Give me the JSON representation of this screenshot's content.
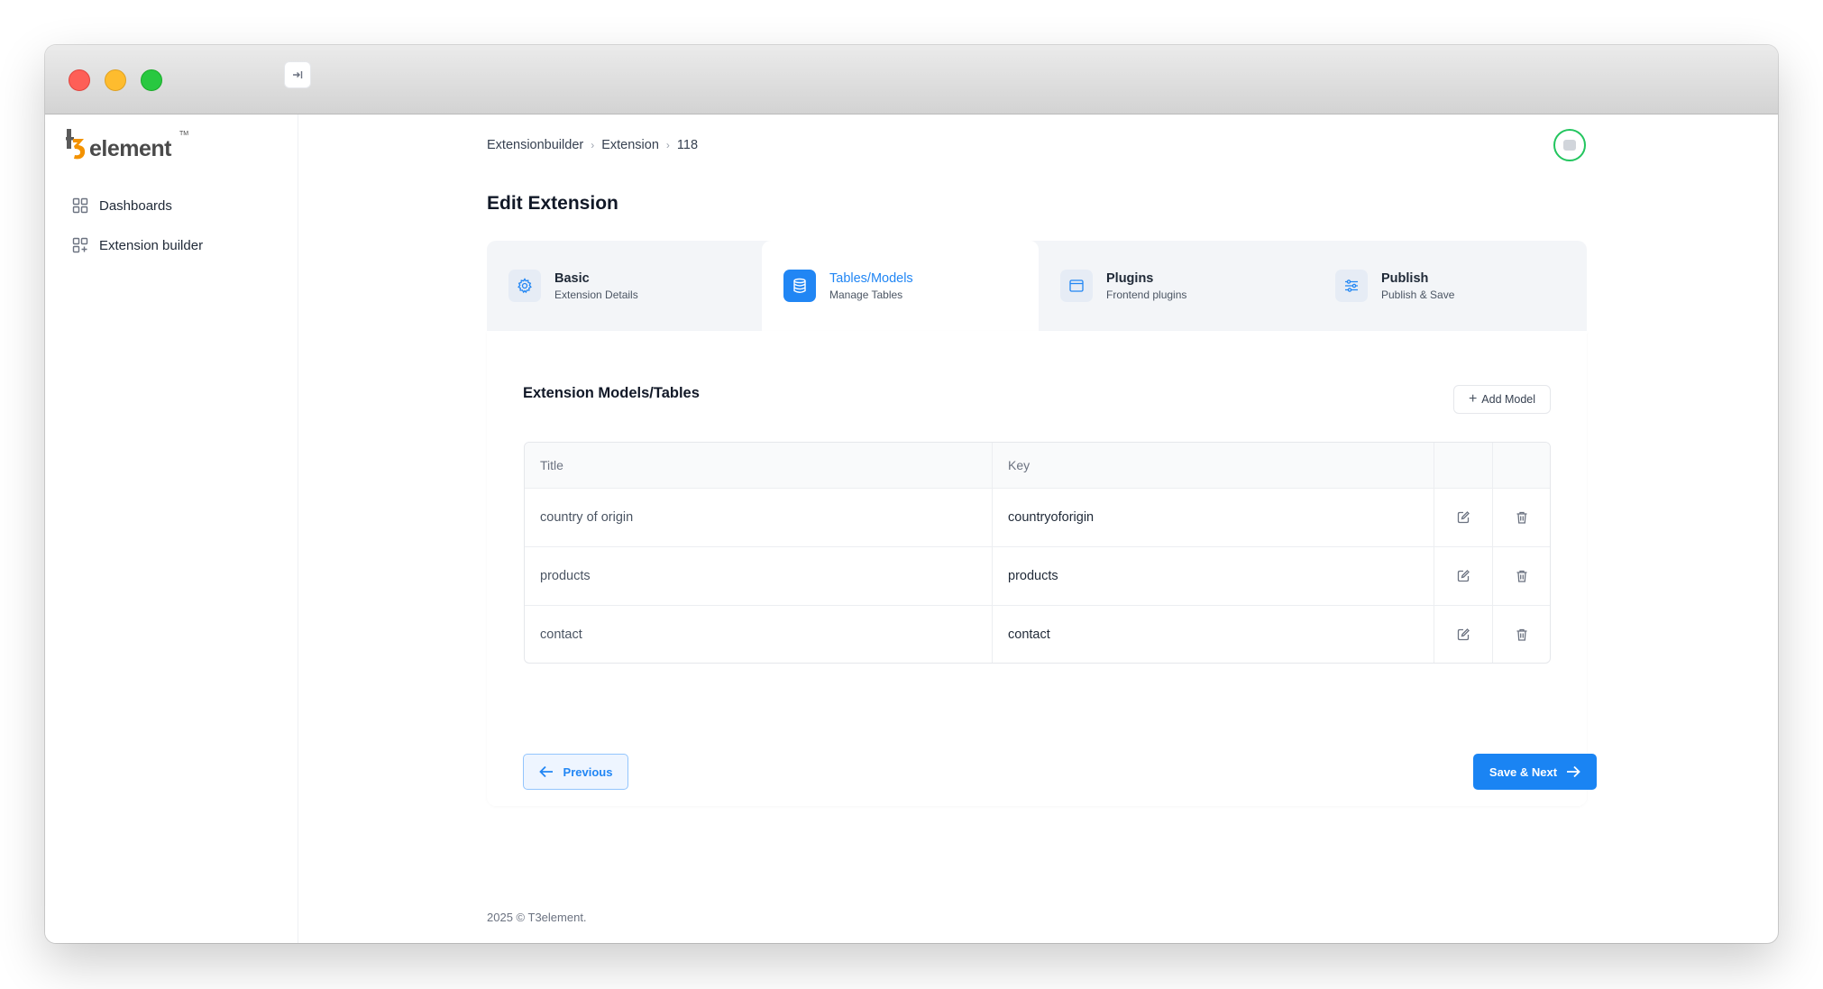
{
  "app": {
    "logo_text": "element",
    "logo_tm": "TM"
  },
  "sidebar": {
    "items": [
      {
        "label": "Dashboards",
        "icon": "grid-icon"
      },
      {
        "label": "Extension builder",
        "icon": "grid-plus-icon"
      }
    ]
  },
  "breadcrumb": [
    "Extensionbuilder",
    "Extension",
    "118"
  ],
  "page": {
    "title": "Edit Extension"
  },
  "steps": [
    {
      "title": "Basic",
      "subtitle": "Extension Details",
      "icon": "gear-icon",
      "active": false
    },
    {
      "title": "Tables/Models",
      "subtitle": "Manage Tables",
      "icon": "database-icon",
      "active": true
    },
    {
      "title": "Plugins",
      "subtitle": "Frontend plugins",
      "icon": "window-icon",
      "active": false
    },
    {
      "title": "Publish",
      "subtitle": "Publish & Save",
      "icon": "sliders-icon",
      "active": false
    }
  ],
  "section": {
    "title": "Extension Models/Tables",
    "add_button": "Add Model"
  },
  "table": {
    "headers": [
      "Title",
      "Key"
    ],
    "rows": [
      {
        "title": "country of origin",
        "key": "countryoforigin"
      },
      {
        "title": "products",
        "key": "products"
      },
      {
        "title": "contact",
        "key": "contact"
      }
    ]
  },
  "actions": {
    "previous": "Previous",
    "next": "Save & Next"
  },
  "footer": {
    "year": "2025 ©",
    "brand": "T3element."
  },
  "colors": {
    "accent": "#2186f4",
    "avatar_ring": "#22c55e",
    "logo_orange": "#f39200"
  }
}
